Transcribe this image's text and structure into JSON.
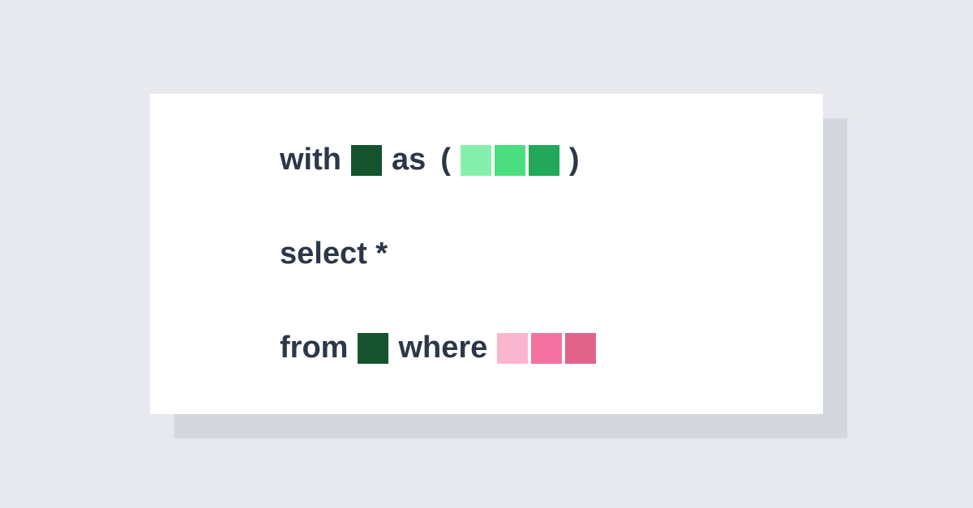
{
  "sql": {
    "line1": {
      "with": "with",
      "as": "as",
      "open_paren": "(",
      "close_paren": ")"
    },
    "line2": {
      "select": "select *"
    },
    "line3": {
      "from": "from",
      "where": "where"
    }
  },
  "colors": {
    "dark_green": "#14532d",
    "light_green": "#86efac",
    "mid_green": "#4ade80",
    "green": "#22a85a",
    "light_pink": "#fbb5ce",
    "mid_pink": "#f472a0",
    "pink": "#e0638a"
  }
}
